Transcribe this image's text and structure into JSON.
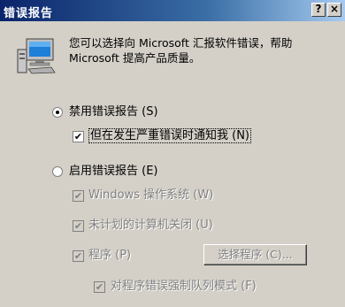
{
  "window": {
    "title": "错误报告",
    "help_glyph": "?",
    "close_glyph": "×"
  },
  "intro_text": "您可以选择向 Microsoft 汇报软件错误，帮助 Microsoft 提高产品质量。",
  "options": {
    "disable": {
      "label": "禁用错误报告 (S)",
      "selected": true,
      "notify": {
        "label": "但在发生严重错误时通知我 (N)",
        "checked": true
      }
    },
    "enable": {
      "label": "启用错误报告 (E)",
      "selected": false,
      "windows_os": {
        "label": "Windows 操作系统 (W)",
        "checked": true,
        "enabled": false
      },
      "unplanned_shutdown": {
        "label": "未计划的计算机关闭 (U)",
        "checked": true,
        "enabled": false
      },
      "programs": {
        "label": "程序 (P)",
        "checked": true,
        "enabled": false
      },
      "choose_programs_button": "选择程序 (C)...",
      "force_queue": {
        "label": "对程序错误强制队列模式 (F)",
        "checked": true,
        "enabled": false
      }
    }
  },
  "check_glyph": "✔"
}
